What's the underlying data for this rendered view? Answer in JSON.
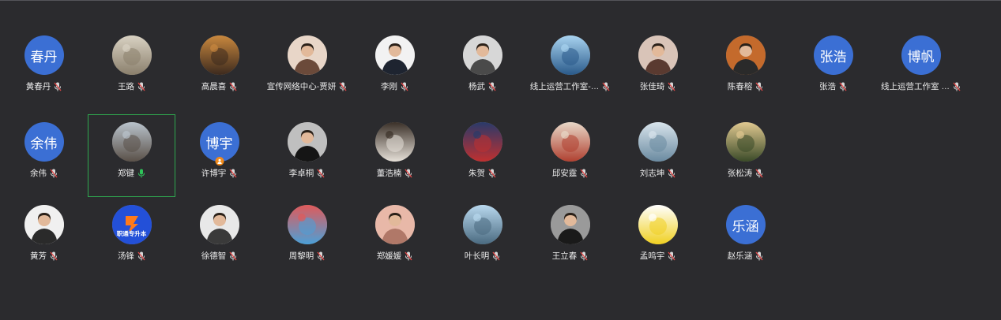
{
  "participants": [
    {
      "name": "黄春丹",
      "avatar_text": "春丹",
      "avatar": "text",
      "mic": "muted",
      "palette": [
        "#3b6fd4",
        "#3b6fd4"
      ]
    },
    {
      "name": "王路",
      "avatar": "photo",
      "avatar_icon": "cat-with-party-hat-photo",
      "mic": "muted",
      "palette": [
        "#d9d2c3",
        "#8a7f6c"
      ]
    },
    {
      "name": "高晨喜",
      "avatar": "photo",
      "avatar_icon": "sunset-silhouette-photo",
      "mic": "muted",
      "palette": [
        "#c9883e",
        "#3c2a1e"
      ]
    },
    {
      "name": "宣传网络中心-贾妍",
      "avatar": "photo",
      "avatar_icon": "woman-portrait-photo",
      "mic": "muted",
      "palette": [
        "#e8d6c8",
        "#6b4a3a"
      ]
    },
    {
      "name": "李刚",
      "avatar": "photo",
      "avatar_icon": "man-in-suit-photo",
      "mic": "muted",
      "palette": [
        "#f2f2f2",
        "#1e2430"
      ]
    },
    {
      "name": "杨武",
      "avatar": "photo",
      "avatar_icon": "man-with-glasses-photo",
      "mic": "muted",
      "palette": [
        "#d7d7d7",
        "#4a4a4a"
      ]
    },
    {
      "name": "线上运营工作室-…",
      "avatar": "photo",
      "avatar_icon": "cartoon-character-photo",
      "mic": "muted",
      "palette": [
        "#a8d3f0",
        "#2a5a8a"
      ]
    },
    {
      "name": "张佳琦",
      "avatar": "photo",
      "avatar_icon": "woman-portrait-photo",
      "mic": "muted",
      "palette": [
        "#d9c4b8",
        "#5a3a30"
      ]
    },
    {
      "name": "陈春榕",
      "avatar": "photo",
      "avatar_icon": "woman-in-black-photo",
      "mic": "muted",
      "palette": [
        "#c46a2c",
        "#2a2a2a"
      ]
    },
    {
      "name": "张浩",
      "avatar_text": "张浩",
      "avatar": "text",
      "mic": "muted",
      "palette": [
        "#3b6fd4",
        "#3b6fd4"
      ]
    },
    {
      "name": "线上运营工作室 …",
      "avatar_text": "博帆",
      "avatar": "text",
      "mic": "muted",
      "palette": [
        "#3b6fd4",
        "#3b6fd4"
      ]
    },
    {
      "name": "余伟",
      "avatar_text": "余伟",
      "avatar": "text",
      "mic": "muted",
      "palette": [
        "#3b6fd4",
        "#3b6fd4"
      ]
    },
    {
      "name": "郑键",
      "avatar": "photo",
      "avatar_icon": "building-photo",
      "mic": "speaking",
      "active": true,
      "palette": [
        "#b9c3cc",
        "#5a5048"
      ]
    },
    {
      "name": "许博宇",
      "avatar_text": "博宇",
      "avatar": "text",
      "mic": "muted",
      "host": true,
      "palette": [
        "#3b6fd4",
        "#3b6fd4"
      ]
    },
    {
      "name": "李卓桐",
      "avatar": "photo",
      "avatar_icon": "man-in-suit-photo",
      "mic": "muted",
      "palette": [
        "#bfbfbf",
        "#151515"
      ]
    },
    {
      "name": "董浩楠",
      "avatar": "photo",
      "avatar_icon": "puppies-photo",
      "mic": "muted",
      "palette": [
        "#3a3028",
        "#e6e0d8"
      ]
    },
    {
      "name": "朱贺",
      "avatar": "photo",
      "avatar_icon": "cartoon-character-photo",
      "mic": "muted",
      "palette": [
        "#2a3a6a",
        "#c03030"
      ]
    },
    {
      "name": "邱安霆",
      "avatar": "photo",
      "avatar_icon": "anime-art-photo",
      "mic": "muted",
      "palette": [
        "#e8d8c8",
        "#b04030"
      ]
    },
    {
      "name": "刘志坤",
      "avatar": "photo",
      "avatar_icon": "landscape-photo",
      "mic": "muted",
      "palette": [
        "#d8e4ec",
        "#6a8aa0"
      ]
    },
    {
      "name": "张松涛",
      "avatar": "photo",
      "avatar_icon": "forest-path-photo",
      "mic": "muted",
      "palette": [
        "#e0c890",
        "#3a4a28"
      ]
    },
    {
      "name": "黄芳",
      "avatar": "photo",
      "avatar_icon": "woman-portrait-photo",
      "mic": "muted",
      "palette": [
        "#f0f0f0",
        "#2a2a2a"
      ]
    },
    {
      "name": "汤锋",
      "avatar": "photo",
      "avatar_icon": "logo-photo",
      "mic": "muted",
      "logo_text": "职通专升本",
      "palette": [
        "#2350d8",
        "#ff7a1a"
      ]
    },
    {
      "name": "徐德智",
      "avatar": "photo",
      "avatar_icon": "boy-portrait-photo",
      "mic": "muted",
      "palette": [
        "#e8e8e8",
        "#3a3a3a"
      ]
    },
    {
      "name": "周黎明",
      "avatar": "photo",
      "avatar_icon": "colorful-scene-photo",
      "mic": "muted",
      "palette": [
        "#e05a5a",
        "#4aa0d8"
      ]
    },
    {
      "name": "郑媛媛",
      "avatar": "photo",
      "avatar_icon": "baby-portrait-photo",
      "mic": "muted",
      "palette": [
        "#e8b8a8",
        "#b07868"
      ]
    },
    {
      "name": "叶长明",
      "avatar": "photo",
      "avatar_icon": "beach-photo",
      "mic": "muted",
      "palette": [
        "#b8d8ee",
        "#4a6a80"
      ]
    },
    {
      "name": "王立春",
      "avatar": "photo",
      "avatar_icon": "man-in-suit-photo",
      "mic": "muted",
      "palette": [
        "#9a9a9a",
        "#1a1a1a"
      ]
    },
    {
      "name": "孟鸣宇",
      "avatar": "photo",
      "avatar_icon": "illustrated-girl-photo",
      "mic": "muted",
      "palette": [
        "#ffffff",
        "#f0d020"
      ]
    },
    {
      "name": "赵乐涵",
      "avatar_text": "乐涵",
      "avatar": "text",
      "mic": "muted",
      "palette": [
        "#3b6fd4",
        "#3b6fd4"
      ]
    }
  ],
  "rows": [
    11,
    9,
    9
  ],
  "colors": {
    "background": "#2b2b2e",
    "avatar_blue": "#3b6fd4",
    "active_border": "#2fa84f",
    "muted_red": "#e04848",
    "host_orange": "#f08a1c",
    "speaking_green": "#2fc45a"
  }
}
